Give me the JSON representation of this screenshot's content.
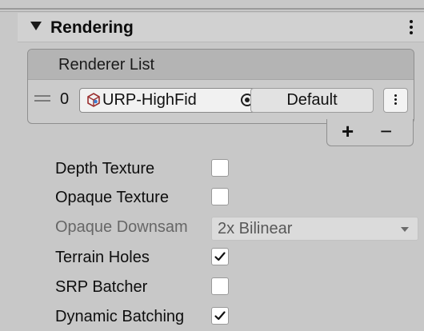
{
  "section": {
    "title": "Rendering"
  },
  "renderer_list": {
    "header": "Renderer List",
    "rows": [
      {
        "index": "0",
        "asset_name": "URP-HighFid",
        "button_label": "Default"
      }
    ],
    "add_label": "+",
    "remove_label": "−"
  },
  "properties": {
    "depth_texture": {
      "label": "Depth Texture",
      "checked": false
    },
    "opaque_texture": {
      "label": "Opaque Texture",
      "checked": false
    },
    "opaque_downsampling": {
      "label": "Opaque Downsam",
      "value": "2x Bilinear"
    },
    "terrain_holes": {
      "label": "Terrain Holes",
      "checked": true
    },
    "srp_batcher": {
      "label": "SRP Batcher",
      "checked": false
    },
    "dynamic_batching": {
      "label": "Dynamic Batching",
      "checked": true
    }
  },
  "icons": {
    "foldout": "triangle-down-icon",
    "menu": "kebab-icon",
    "asset": "pipeline-asset-icon",
    "picker": "object-picker-icon",
    "handle": "drag-handle-icon"
  }
}
